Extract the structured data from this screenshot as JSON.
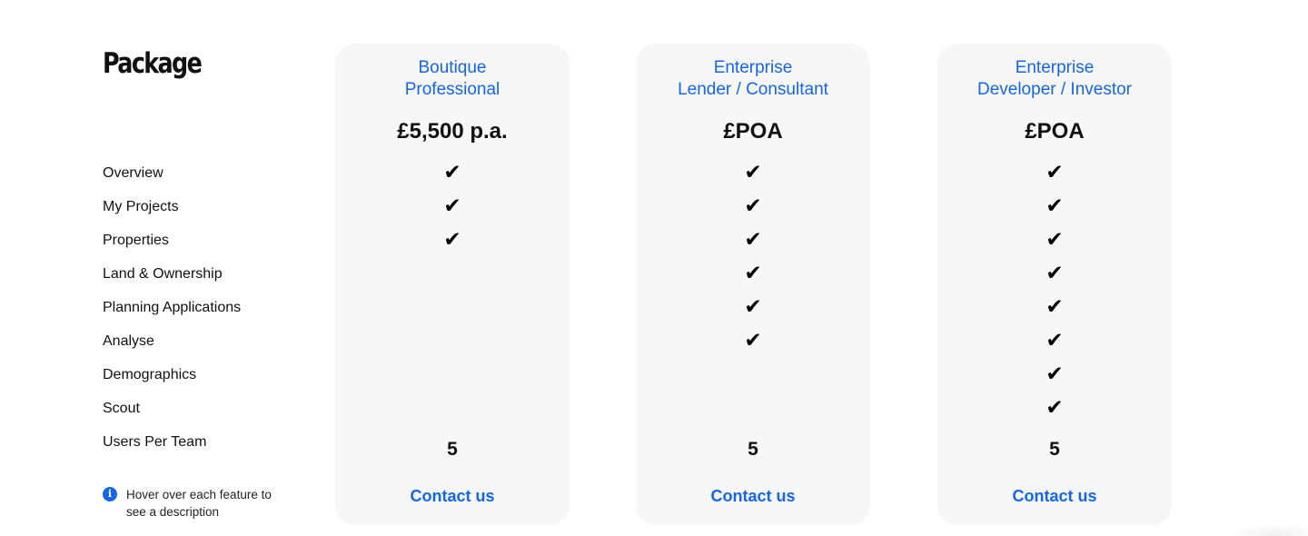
{
  "package_title": "Package",
  "features": [
    "Overview",
    "My Projects",
    "Properties",
    "Land & Ownership",
    "Planning Applications",
    "Analyse",
    "Demographics",
    "Scout"
  ],
  "users_label": "Users Per Team",
  "hint": {
    "icon": "info-icon",
    "icon_glyph": "i",
    "text": "Hover over each feature to see a description"
  },
  "check_glyph": "✔",
  "plans": [
    {
      "name_line1": "Boutique",
      "name_line2": "Professional",
      "price": "£5,500 p.a.",
      "includes": [
        true,
        true,
        true,
        false,
        false,
        false,
        false,
        false
      ],
      "users": "5",
      "cta": "Contact us"
    },
    {
      "name_line1": "Enterprise",
      "name_line2": "Lender / Consultant",
      "price": "£POA",
      "includes": [
        true,
        true,
        true,
        true,
        true,
        true,
        false,
        false
      ],
      "users": "5",
      "cta": "Contact us"
    },
    {
      "name_line1": "Enterprise",
      "name_line2": "Developer / Investor",
      "price": "£POA",
      "includes": [
        true,
        true,
        true,
        true,
        true,
        true,
        true,
        true
      ],
      "users": "5",
      "cta": "Contact us"
    }
  ],
  "colors": {
    "accent": "#1466e8",
    "card_background": "#f7f7f7",
    "text": "#111111"
  }
}
